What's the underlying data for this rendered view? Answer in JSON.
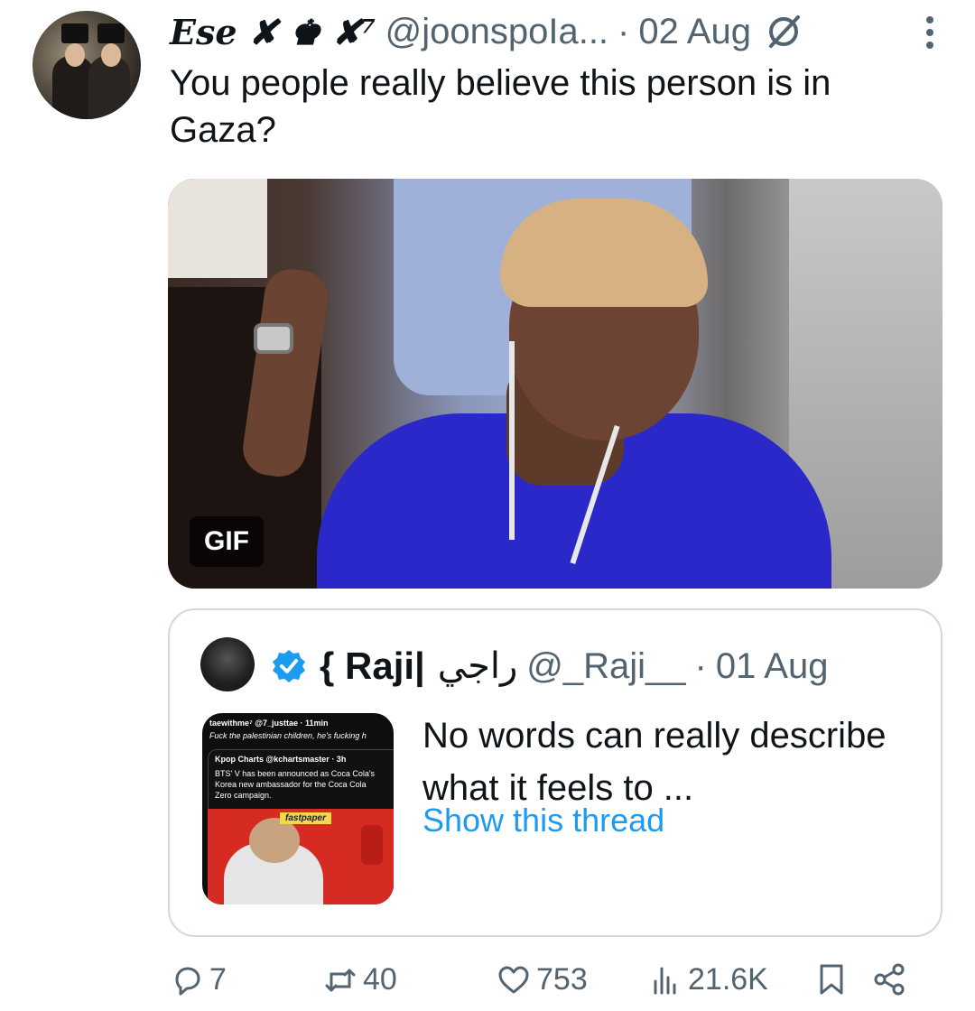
{
  "tweet": {
    "author_name": "Ese ✘ ♚ ✘⁷",
    "handle": "@joonspoIa...",
    "separator": "·",
    "date": "02 Aug",
    "text": "You people really believe this person is in Gaza?",
    "media_badge": "GIF"
  },
  "quote": {
    "name": "{ Raji|",
    "arabic_name": "راجي",
    "handle": "@_Raji__",
    "separator": "·",
    "date": "01 Aug",
    "text": "No words can really describe what it feels to ...",
    "show_thread": "Show this thread",
    "thumb": {
      "line1": "taewithme⁷ @7_justtae · 11min",
      "line2": "Fuck the palestinian children, he's fucking h",
      "line3": "Kpop Charts @kchartsmaster · 3h",
      "line4": "BTS' V has been announced as Coca Cola's",
      "line5": "Korea new ambassador for the Coca Cola",
      "line6": "Zero campaign.",
      "tag": "fastpaper"
    }
  },
  "actions": {
    "replies": "7",
    "retweets": "40",
    "likes": "753",
    "views": "21.6K"
  },
  "colors": {
    "text": "#0f1419",
    "secondary": "#536471",
    "link": "#1d9bf0",
    "border": "#cfd9de"
  }
}
